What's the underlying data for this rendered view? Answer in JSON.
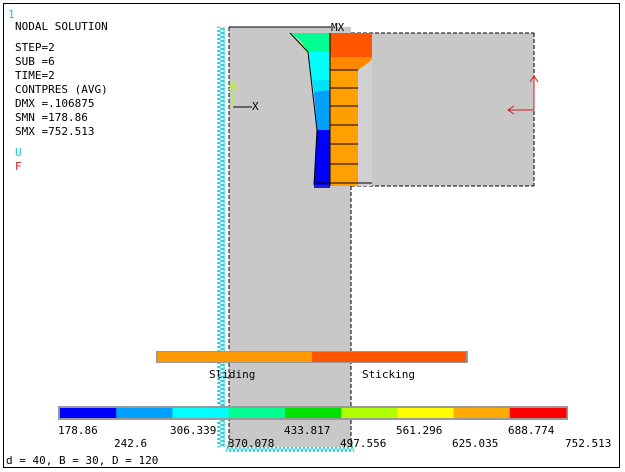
{
  "window_number": "1",
  "header": {
    "title": "NODAL SOLUTION",
    "lines": [
      "STEP=2",
      "SUB =6",
      "TIME=2",
      "CONTPRES (AVG)",
      "DMX =.106875",
      "SMN =178.86",
      "SMX =752.513"
    ]
  },
  "legend_symbols": {
    "u_label": "U",
    "u_color": "#19c9d6",
    "f_label": "F",
    "f_color": "#d11a1a"
  },
  "triad": {
    "x_label": "X",
    "mx_label": "MX"
  },
  "status_bar": {
    "sliding_label": "Sliding",
    "sticking_label": "Sticking",
    "sliding_color": "#ff9900",
    "sticking_color": "#ff5500"
  },
  "contour_legend": {
    "colors": [
      "#0000ff",
      "#00a0ff",
      "#00ffff",
      "#00ff90",
      "#00e000",
      "#b0ff00",
      "#ffff00",
      "#ffaa00",
      "#ff0000"
    ],
    "top_values": [
      "178.86",
      "306.339",
      "433.817",
      "561.296",
      "688.774"
    ],
    "bottom_values": [
      "242.6",
      "370.078",
      "497.556",
      "625.035",
      "752.513"
    ]
  },
  "footer_text": "d = 40, B = 30, D = 120",
  "colors": {
    "body_gray": "#c8c8c8",
    "outline": "#000000",
    "constraint_cyan": "#19c9d6",
    "force_red": "#d11a1a"
  }
}
